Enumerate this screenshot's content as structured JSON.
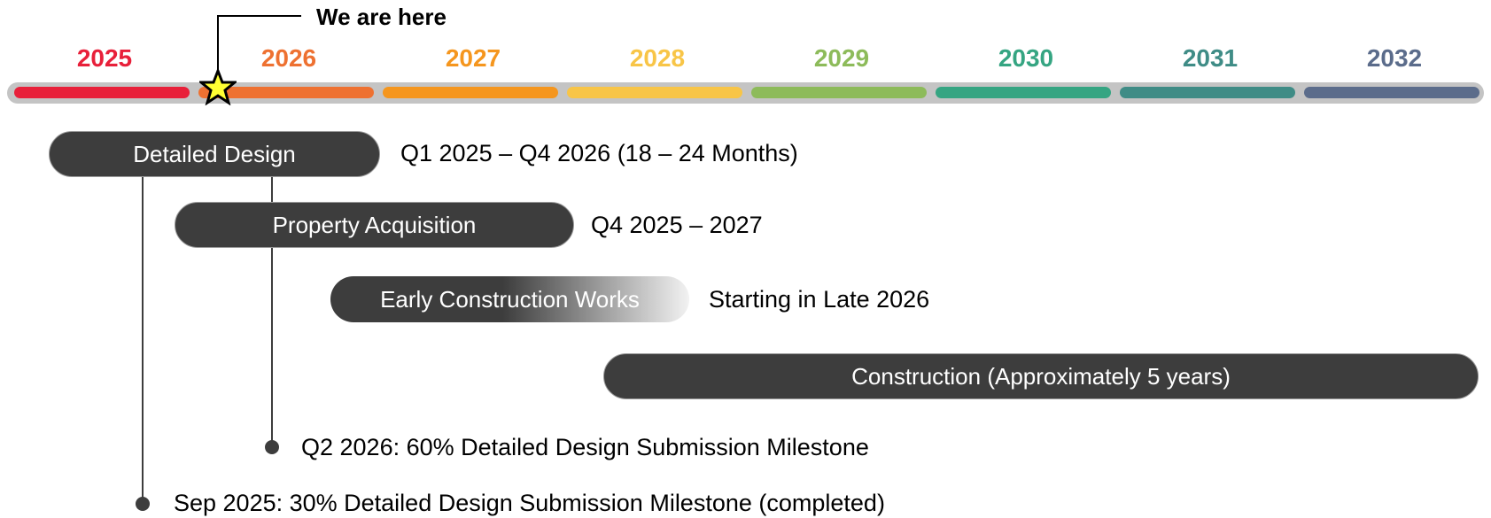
{
  "callout": {
    "label": "We are here"
  },
  "years": [
    {
      "label": "2025",
      "color": "#e8203a"
    },
    {
      "label": "2026",
      "color": "#ee7131"
    },
    {
      "label": "2027",
      "color": "#f5961e"
    },
    {
      "label": "2028",
      "color": "#f8c547"
    },
    {
      "label": "2029",
      "color": "#8dbb5a"
    },
    {
      "label": "2030",
      "color": "#35a582"
    },
    {
      "label": "2031",
      "color": "#3f8c86"
    },
    {
      "label": "2032",
      "color": "#5b6c8b"
    }
  ],
  "phases": [
    {
      "label": "Detailed Design",
      "timing": "Q1 2025 – Q4 2026 (18 – 24 Months)"
    },
    {
      "label": "Property Acquisition",
      "timing": "Q4 2025 – 2027"
    },
    {
      "label": "Early Construction Works",
      "timing": "Starting in Late 2026"
    },
    {
      "label": "Construction (Approximately 5 years)"
    }
  ],
  "milestones": [
    {
      "label": "Q2 2026: 60% Detailed Design Submission Milestone"
    },
    {
      "label": "Sep 2025: 30% Detailed Design Submission Milestone (completed)"
    }
  ]
}
